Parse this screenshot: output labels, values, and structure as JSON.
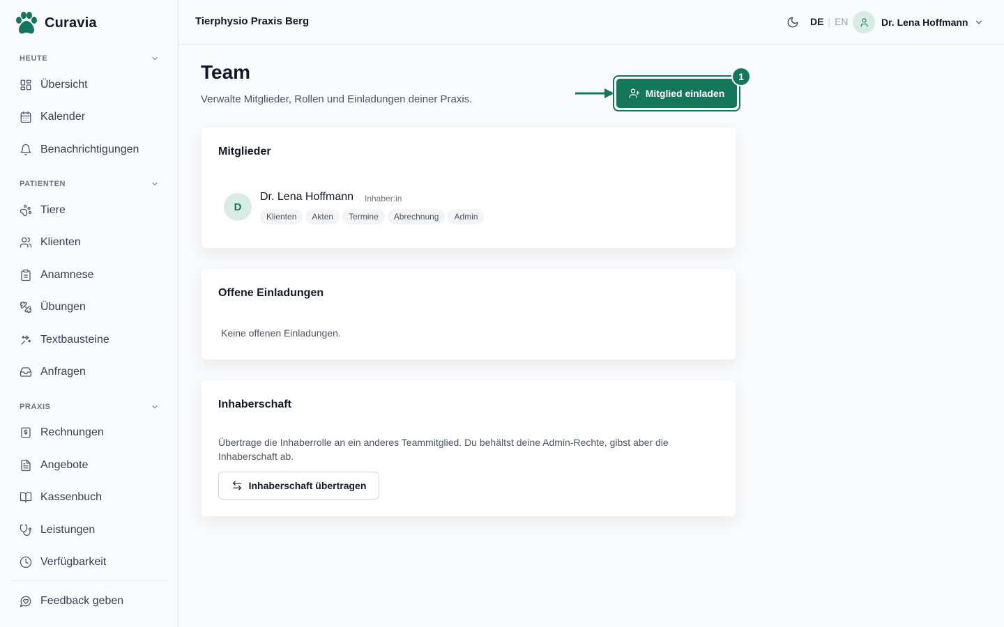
{
  "app": {
    "name": "Curavia"
  },
  "header": {
    "practice_name": "Tierphysio Praxis Berg",
    "lang_active": "DE",
    "lang_separator": "|",
    "lang_other": "EN",
    "user_name": "Dr. Lena Hoffmann"
  },
  "sidebar": {
    "sections": [
      {
        "label": "HEUTE"
      },
      {
        "label": "PATIENTEN"
      },
      {
        "label": "PRAXIS"
      }
    ],
    "items": [
      {
        "label": "Übersicht",
        "icon": "layout-grid-icon"
      },
      {
        "label": "Kalender",
        "icon": "calendar-icon"
      },
      {
        "label": "Benachrichtigungen",
        "icon": "bell-icon"
      },
      {
        "label": "Tiere",
        "icon": "paw-icon"
      },
      {
        "label": "Klienten",
        "icon": "users-icon"
      },
      {
        "label": "Anamnese",
        "icon": "clipboard-icon"
      },
      {
        "label": "Übungen",
        "icon": "dumbbell-icon"
      },
      {
        "label": "Textbausteine",
        "icon": "sparkles-icon"
      },
      {
        "label": "Anfragen",
        "icon": "inbox-icon"
      },
      {
        "label": "Rechnungen",
        "icon": "receipt-icon"
      },
      {
        "label": "Angebote",
        "icon": "file-text-icon"
      },
      {
        "label": "Kassenbuch",
        "icon": "book-open-icon"
      },
      {
        "label": "Leistungen",
        "icon": "stethoscope-icon"
      },
      {
        "label": "Verfügbarkeit",
        "icon": "clock-icon"
      }
    ],
    "feedback": {
      "label": "Feedback geben",
      "icon": "message-heart-icon"
    }
  },
  "main": {
    "title": "Team",
    "subtitle": "Verwalte Mitglieder, Rollen und Einladungen deiner Praxis.",
    "invite_button": "Mitglied einladen",
    "step_badge": "1",
    "members": {
      "title": "Mitglieder",
      "list": [
        {
          "initial": "D",
          "name": "Dr. Lena Hoffmann",
          "role": "Inhaber:in",
          "permissions": [
            "Klienten",
            "Akten",
            "Termine",
            "Abrechnung",
            "Admin"
          ]
        }
      ]
    },
    "invitations": {
      "title": "Offene Einladungen",
      "empty_text": "Keine offenen Einladungen."
    },
    "ownership": {
      "title": "Inhaberschaft",
      "text": "Übertrage die Inhaberrolle an ein anderes Teammitglied. Du behältst deine Admin-Rechte, gibst aber die Inhaberschaft ab.",
      "button": "Inhaberschaft übertragen"
    }
  },
  "colors": {
    "accent": "#14765a",
    "accent_light": "#d9ebe4",
    "background": "#f9fafb"
  }
}
